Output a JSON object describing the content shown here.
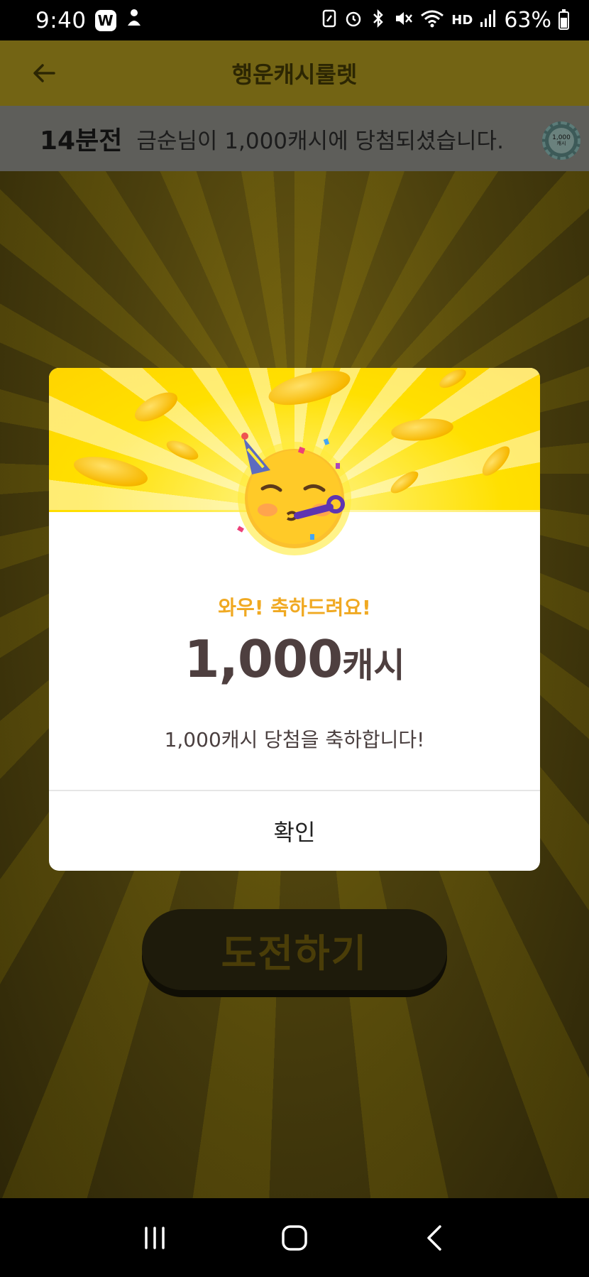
{
  "status_bar": {
    "time": "9:40",
    "app_badge": "W",
    "signal_label": "HD",
    "battery": "63%"
  },
  "header": {
    "title": "행운캐시룰렛",
    "back_icon": "arrow-left-icon"
  },
  "ticker": {
    "time_ago": "14분전",
    "message": "금순님이 1,000캐시에 당첨되셨습니다.",
    "chip_amount": "1,000",
    "chip_unit": "캐시"
  },
  "main": {
    "challenge_button": "도전하기"
  },
  "modal": {
    "congrats": "와우! 축하드려요!",
    "prize_amount": "1,000",
    "prize_unit": "캐시",
    "message": "1,000캐시 당첨을 축하합니다!",
    "confirm": "확인",
    "emoji_icon": "party-face-emoji-icon"
  },
  "nav": {
    "recent": "recent-apps-icon",
    "home": "home-icon",
    "back": "back-chevron-icon"
  },
  "colors": {
    "accent_yellow": "#ffe000",
    "congrats_orange": "#f0a922",
    "prize_text": "#4e3f3f"
  }
}
